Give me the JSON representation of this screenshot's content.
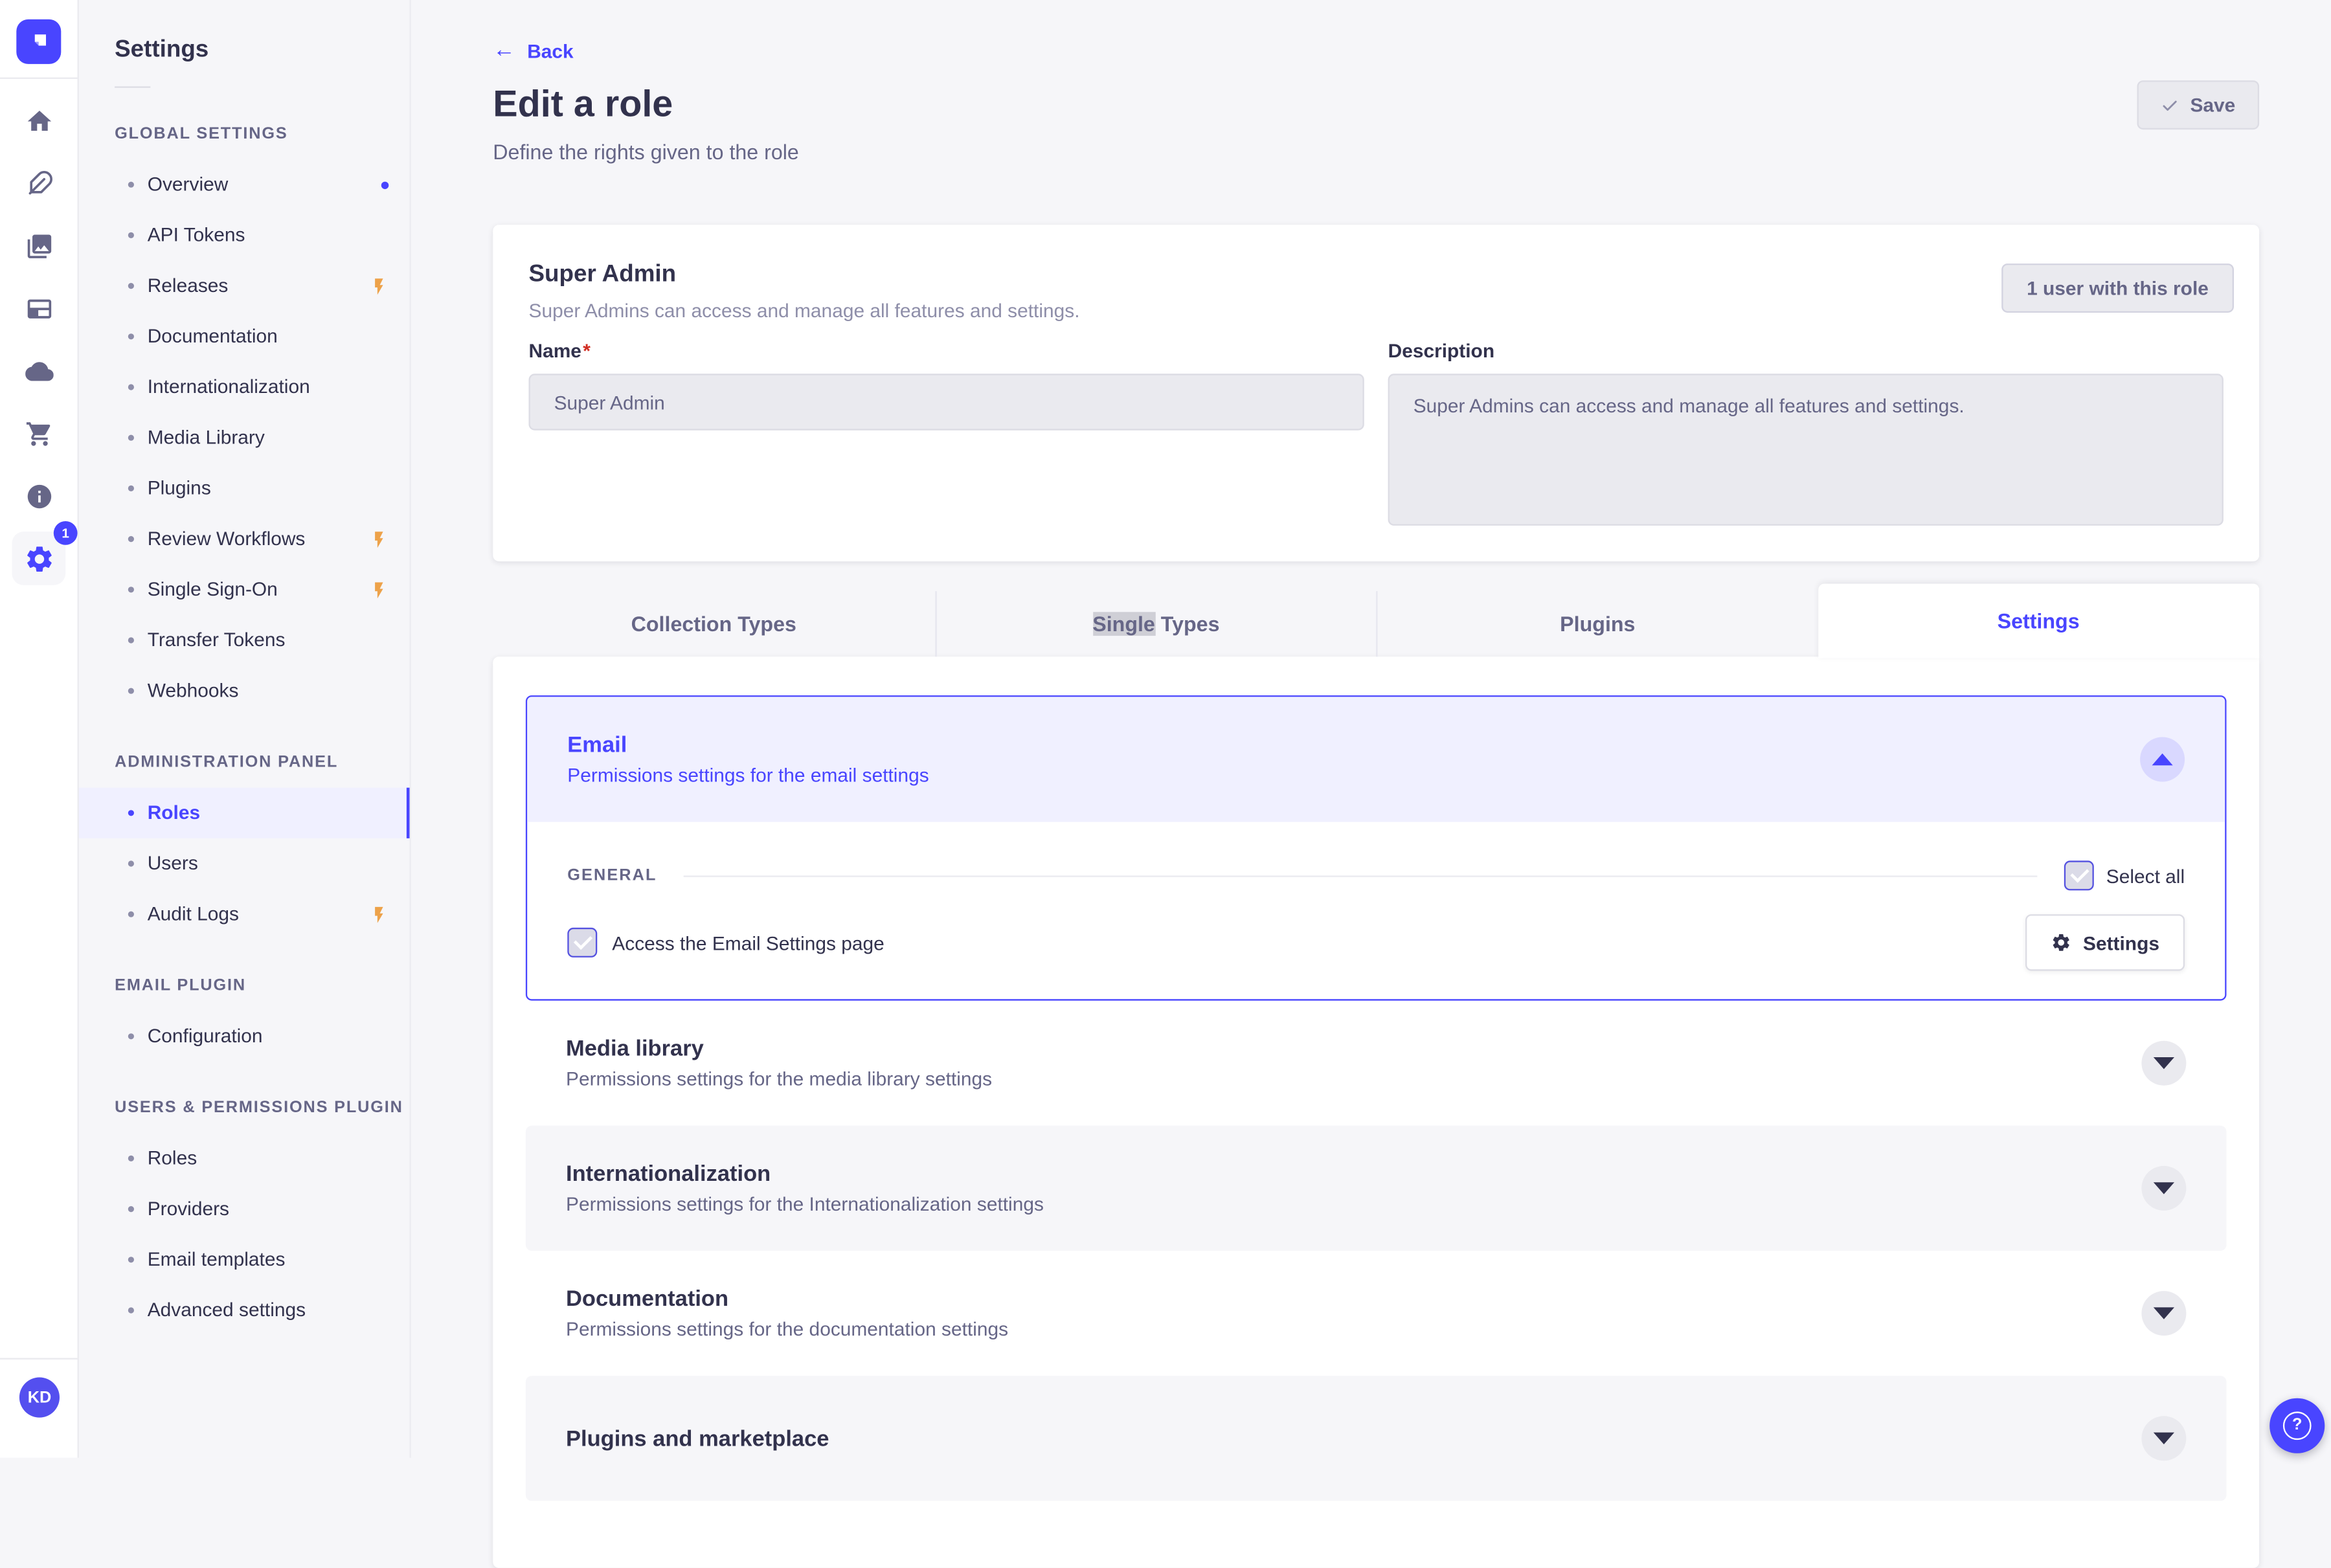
{
  "colors": {
    "primary": "#4945FF",
    "primary_light_bg": "#F0F0FF",
    "bolt_orange": "#EDA24A",
    "text_dark": "#32324D",
    "text_gray": "#666687",
    "disabled_input_bg": "#EAEAEF",
    "selection_highlight": "#CFCFD6",
    "accordion_border": "#4945FF"
  },
  "rail": {
    "logo": "strapi-logo",
    "settings_badge": "1",
    "avatar_initials": "KD",
    "icons": [
      "home-icon",
      "pen-icon",
      "media-library-icon",
      "content-manager-icon",
      "cloud-icon",
      "marketplace-cart-icon",
      "info-icon",
      "settings-gear-icon"
    ]
  },
  "sidebar": {
    "title": "Settings",
    "sections": [
      {
        "label": "GLOBAL SETTINGS",
        "items": [
          {
            "label": "Overview",
            "dot": true
          },
          {
            "label": "API Tokens"
          },
          {
            "label": "Releases",
            "bolt": true
          },
          {
            "label": "Documentation"
          },
          {
            "label": "Internationalization"
          },
          {
            "label": "Media Library"
          },
          {
            "label": "Plugins"
          },
          {
            "label": "Review Workflows",
            "bolt": true
          },
          {
            "label": "Single Sign-On",
            "bolt": true
          },
          {
            "label": "Transfer Tokens"
          },
          {
            "label": "Webhooks"
          }
        ]
      },
      {
        "label": "ADMINISTRATION PANEL",
        "items": [
          {
            "label": "Roles",
            "active": true
          },
          {
            "label": "Users"
          },
          {
            "label": "Audit Logs",
            "bolt": true
          }
        ]
      },
      {
        "label": "EMAIL PLUGIN",
        "items": [
          {
            "label": "Configuration"
          }
        ]
      },
      {
        "label": "USERS & PERMISSIONS PLUGIN",
        "items": [
          {
            "label": "Roles"
          },
          {
            "label": "Providers"
          },
          {
            "label": "Email templates"
          },
          {
            "label": "Advanced settings"
          }
        ]
      }
    ]
  },
  "header": {
    "back": "Back",
    "title": "Edit a role",
    "subtitle": "Define the rights given to the role",
    "save": "Save"
  },
  "role_card": {
    "name": "Super Admin",
    "summary": "Super Admins can access and manage all features and settings.",
    "users_button": "1 user with this role",
    "name_label": "Name",
    "required_mark": "*",
    "name_value": "Super Admin",
    "description_label": "Description",
    "description_value": "Super Admins can access and manage all features and settings."
  },
  "tabs": {
    "labels": [
      "Collection Types",
      "Single Types",
      "Plugins",
      "Settings"
    ],
    "active": "Settings",
    "single_word": "Single",
    "single_rest": " Types"
  },
  "permissions": {
    "email": {
      "title": "Email",
      "subtitle": "Permissions settings for the email settings",
      "group_label": "GENERAL",
      "select_all_label": "Select all",
      "select_all_checked": true,
      "item_label": "Access the Email Settings page",
      "item_checked": true,
      "settings_button": "Settings",
      "expanded": true
    },
    "rows": [
      {
        "title": "Media library",
        "subtitle": "Permissions settings for the media library settings"
      },
      {
        "title": "Internationalization",
        "subtitle": "Permissions settings for the Internationalization settings"
      },
      {
        "title": "Documentation",
        "subtitle": "Permissions settings for the documentation settings"
      },
      {
        "title": "Plugins and marketplace"
      }
    ]
  },
  "help": {
    "label": "?"
  }
}
